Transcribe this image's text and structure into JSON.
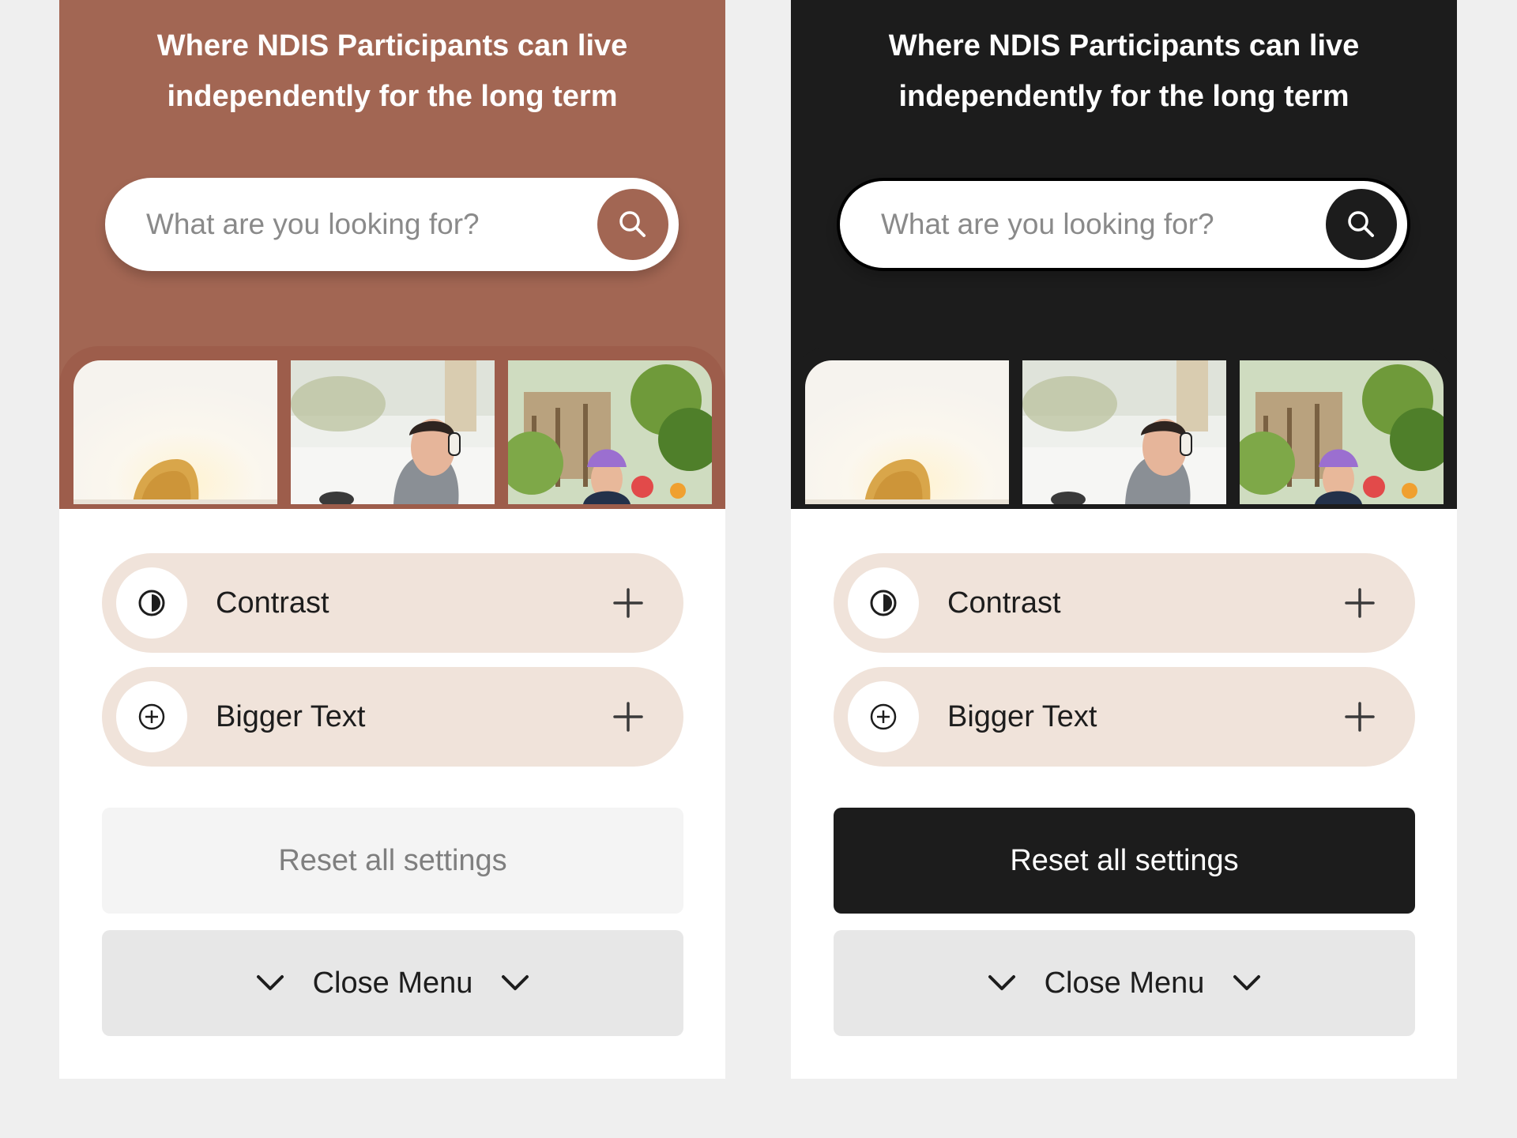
{
  "colors": {
    "brown_theme": "#a26653",
    "dark_theme": "#1c1c1c",
    "option_bg": "#f0e3da",
    "close_bg": "#e7e7e7"
  },
  "panels": [
    {
      "theme": "brown",
      "headline_line1": "Where NDIS Participants can live",
      "headline_line2": "independently for the long term",
      "search": {
        "placeholder": "What are you looking for?",
        "value": "",
        "button_icon": "search-icon"
      },
      "options": [
        {
          "label": "Contrast",
          "icon": "contrast-icon",
          "action_icon": "plus-icon"
        },
        {
          "label": "Bigger Text",
          "icon": "circle-plus-icon",
          "action_icon": "plus-icon"
        }
      ],
      "reset_label": "Reset all settings",
      "close_label": "Close Menu"
    },
    {
      "theme": "dark",
      "headline_line1": "Where NDIS Participants can live",
      "headline_line2": "independently for the long term",
      "search": {
        "placeholder": "What are you looking for?",
        "value": "",
        "button_icon": "search-icon"
      },
      "options": [
        {
          "label": "Contrast",
          "icon": "contrast-icon",
          "action_icon": "plus-icon"
        },
        {
          "label": "Bigger Text",
          "icon": "circle-plus-icon",
          "action_icon": "plus-icon"
        }
      ],
      "reset_label": "Reset all settings",
      "close_label": "Close Menu"
    }
  ]
}
